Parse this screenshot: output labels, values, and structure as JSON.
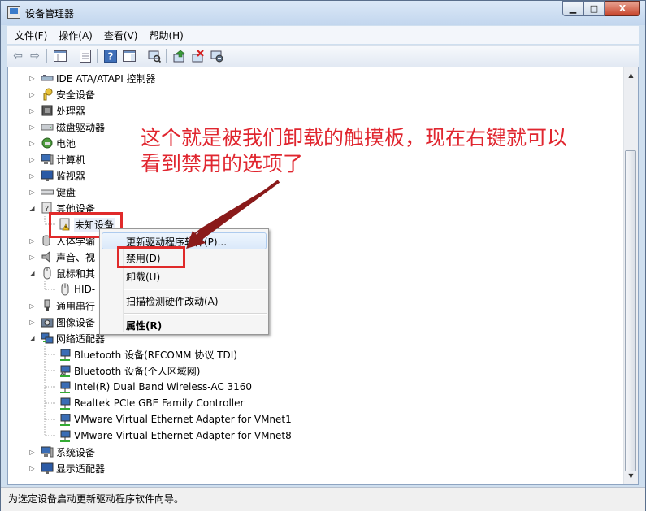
{
  "window": {
    "title": "设备管理器",
    "buttons": {
      "minimize": "▁",
      "maximize": "□",
      "close": "X"
    }
  },
  "menubar": [
    {
      "label": "文件(F)"
    },
    {
      "label": "操作(A)"
    },
    {
      "label": "查看(V)"
    },
    {
      "label": "帮助(H)"
    }
  ],
  "toolbar": {
    "icons": [
      "back-arrow-icon",
      "forward-arrow-icon",
      "show-hide-tree-icon",
      "properties-icon",
      "help-icon",
      "action-pane-icon",
      "scan-hardware-icon",
      "update-driver-icon",
      "uninstall-icon",
      "disable-icon"
    ]
  },
  "tree": {
    "categories": [
      {
        "label": "IDE ATA/ATAPI 控制器",
        "icon": "ide-controller-icon",
        "expanded": false
      },
      {
        "label": "安全设备",
        "icon": "security-key-icon",
        "expanded": false
      },
      {
        "label": "处理器",
        "icon": "processor-icon",
        "expanded": false
      },
      {
        "label": "磁盘驱动器",
        "icon": "disk-drive-icon",
        "expanded": false
      },
      {
        "label": "电池",
        "icon": "battery-icon",
        "expanded": false
      },
      {
        "label": "计算机",
        "icon": "computer-icon",
        "expanded": false
      },
      {
        "label": "监视器",
        "icon": "monitor-icon",
        "expanded": false
      },
      {
        "label": "键盘",
        "icon": "keyboard-icon",
        "expanded": false
      },
      {
        "label": "其他设备",
        "icon": "unknown-device-icon",
        "expanded": true
      },
      {
        "label": "人体学输",
        "icon": "hid-icon",
        "expanded": false
      },
      {
        "label": "声音、视",
        "icon": "speaker-icon",
        "expanded": false
      },
      {
        "label": "鼠标和其",
        "icon": "mouse-icon",
        "expanded": true
      },
      {
        "label": "通用串行",
        "icon": "usb-icon",
        "expanded": false
      },
      {
        "label": "图像设备",
        "icon": "camera-icon",
        "expanded": false
      },
      {
        "label": "网络适配器",
        "icon": "network-adapter-icon",
        "expanded": true
      },
      {
        "label": "系统设备",
        "icon": "system-device-icon",
        "expanded": false
      },
      {
        "label": "显示适配器",
        "icon": "display-adapter-icon",
        "expanded": false
      }
    ],
    "unknown_device": "未知设备",
    "mouse_child": "HID-",
    "network_adapters": [
      "Bluetooth 设备(RFCOMM 协议 TDI)",
      "Bluetooth 设备(个人区域网)",
      "Intel(R) Dual Band Wireless-AC 3160",
      "Realtek PCIe GBE Family Controller",
      "VMware Virtual Ethernet Adapter for VMnet1",
      "VMware Virtual Ethernet Adapter for VMnet8"
    ]
  },
  "context_menu": {
    "update_driver": "更新驱动程序软件(P)...",
    "disable": "禁用(D)",
    "uninstall": "卸载(U)",
    "scan": "扫描检测硬件改动(A)",
    "properties": "属性(R)"
  },
  "annotation": {
    "line1": "这个就是被我们卸载的触摸板，现在右键就可以",
    "line2": "看到禁用的选项了",
    "color": "#e0262f"
  },
  "statusbar": {
    "text": "为选定设备启动更新驱动程序软件向导。"
  }
}
